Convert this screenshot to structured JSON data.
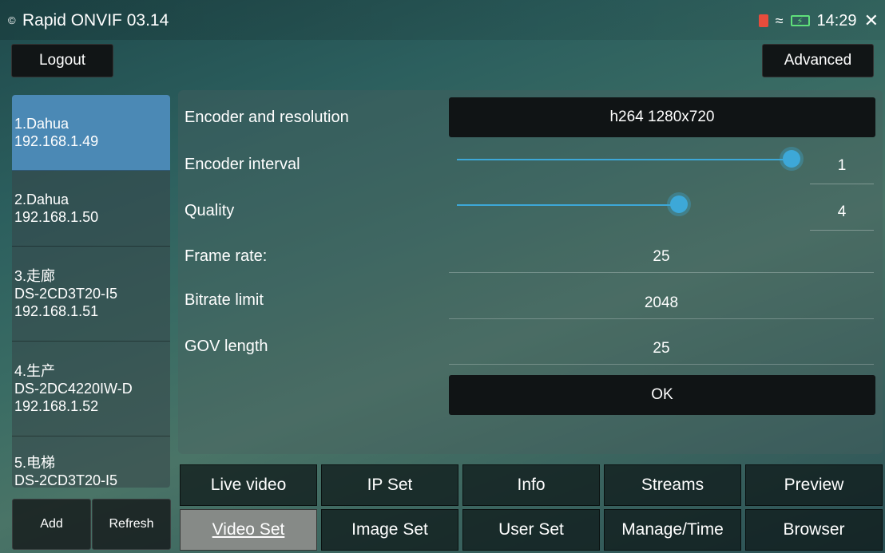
{
  "status_bar": {
    "app_title": "Rapid ONVIF 03.14",
    "time": "14:29"
  },
  "toolbar": {
    "logout_label": "Logout",
    "advanced_label": "Advanced"
  },
  "devices": [
    {
      "line1": "1.Dahua",
      "line2": "192.168.1.49",
      "line3": ""
    },
    {
      "line1": "2.Dahua",
      "line2": "192.168.1.50",
      "line3": ""
    },
    {
      "line1": "3.走廊",
      "line2": "DS-2CD3T20-I5",
      "line3": "192.168.1.51"
    },
    {
      "line1": "4.生产",
      "line2": "DS-2DC4220IW-D",
      "line3": "192.168.1.52"
    },
    {
      "line1": "5.电梯",
      "line2": "DS-2CD3T20-I5",
      "line3": ""
    }
  ],
  "sidebar_buttons": {
    "add_label": "Add",
    "refresh_label": "Refresh"
  },
  "settings": {
    "encoder_label": "Encoder and resolution",
    "encoder_value": "h264 1280x720",
    "interval_label": "Encoder interval",
    "interval_value": "1",
    "interval_level": 1.0,
    "quality_label": "Quality",
    "quality_value": "4",
    "quality_level": 0.655,
    "framerate_label": "Frame rate:",
    "framerate_value": "25",
    "bitrate_label": "Bitrate limit",
    "bitrate_value": "2048",
    "gov_label": "GOV length",
    "gov_value": "25",
    "ok_label": "OK"
  },
  "tabs_row1": [
    "Live video",
    "IP Set",
    "Info",
    "Streams",
    "Preview"
  ],
  "tabs_row2": [
    "Video Set",
    "Image Set",
    "User Set",
    "Manage/Time",
    "Browser"
  ],
  "active_tab": "Video Set",
  "colors": {
    "accent": "#3da8d8",
    "selected_device": "#4b89b5",
    "active_tab": "#868a87"
  }
}
